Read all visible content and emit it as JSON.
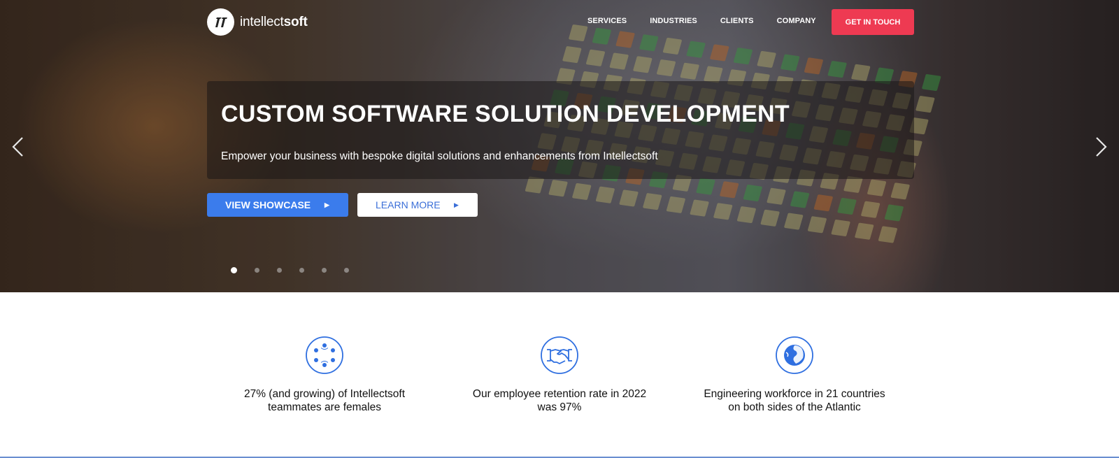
{
  "header": {
    "logo": {
      "text_light": "intellect",
      "text_bold": "soft",
      "icon": "intellectsoft-logo-icon"
    },
    "nav": [
      "SERVICES",
      "INDUSTRIES",
      "CLIENTS",
      "COMPANY"
    ],
    "cta_label": "GET IN TOUCH"
  },
  "hero": {
    "title": "CUSTOM SOFTWARE SOLUTION DEVELOPMENT",
    "subtitle": "Empower your business with bespoke digital solutions and enhancements from Intellectsoft",
    "primary_button": "VIEW SHOWCASE",
    "secondary_button": "LEARN MORE",
    "arrows": {
      "prev": "chevron-left-icon",
      "next": "chevron-right-icon"
    },
    "carousel": {
      "total_slides": 6,
      "active_slide": 1
    }
  },
  "stats": [
    {
      "icon": "team-circle-icon",
      "line1": "27% (and growing) of Intellectsoft",
      "line2": "teammates are females"
    },
    {
      "icon": "handshake-icon",
      "line1": "Our employee retention rate in 2022",
      "line2": "was 97%"
    },
    {
      "icon": "globe-icon",
      "line1": "Engineering workforce in 21 countries",
      "line2": "on both sides of the Atlantic"
    }
  ],
  "colors": {
    "accent_blue": "#3b7cec",
    "cta_red": "#ee3a52",
    "icon_blue": "#2f6fe0"
  }
}
